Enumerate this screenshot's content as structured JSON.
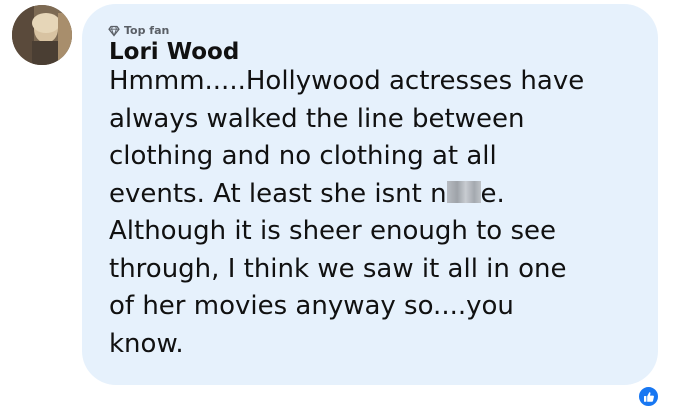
{
  "comment": {
    "author": "Lori Wood",
    "badge": {
      "label": "Top fan",
      "icon": "diamond-badge-icon"
    },
    "avatar_icon": "profile-photo",
    "text_lines": [
      "Hmmm.....Hollywood actresses have",
      "always walked the line between",
      "clothing and no clothing at all",
      "events. At least she isnt n",
      "e.",
      "Although it is sheer enough to see",
      "through, I think we saw it all in one",
      "of her movies anyway so....you",
      "know."
    ],
    "reaction_icon": "like-thumbs-up-icon"
  },
  "colors": {
    "bubble_bg": "#e6f1fc",
    "text": "#111111",
    "badge_text": "#5a5f66",
    "like_blue": "#1877f2"
  }
}
